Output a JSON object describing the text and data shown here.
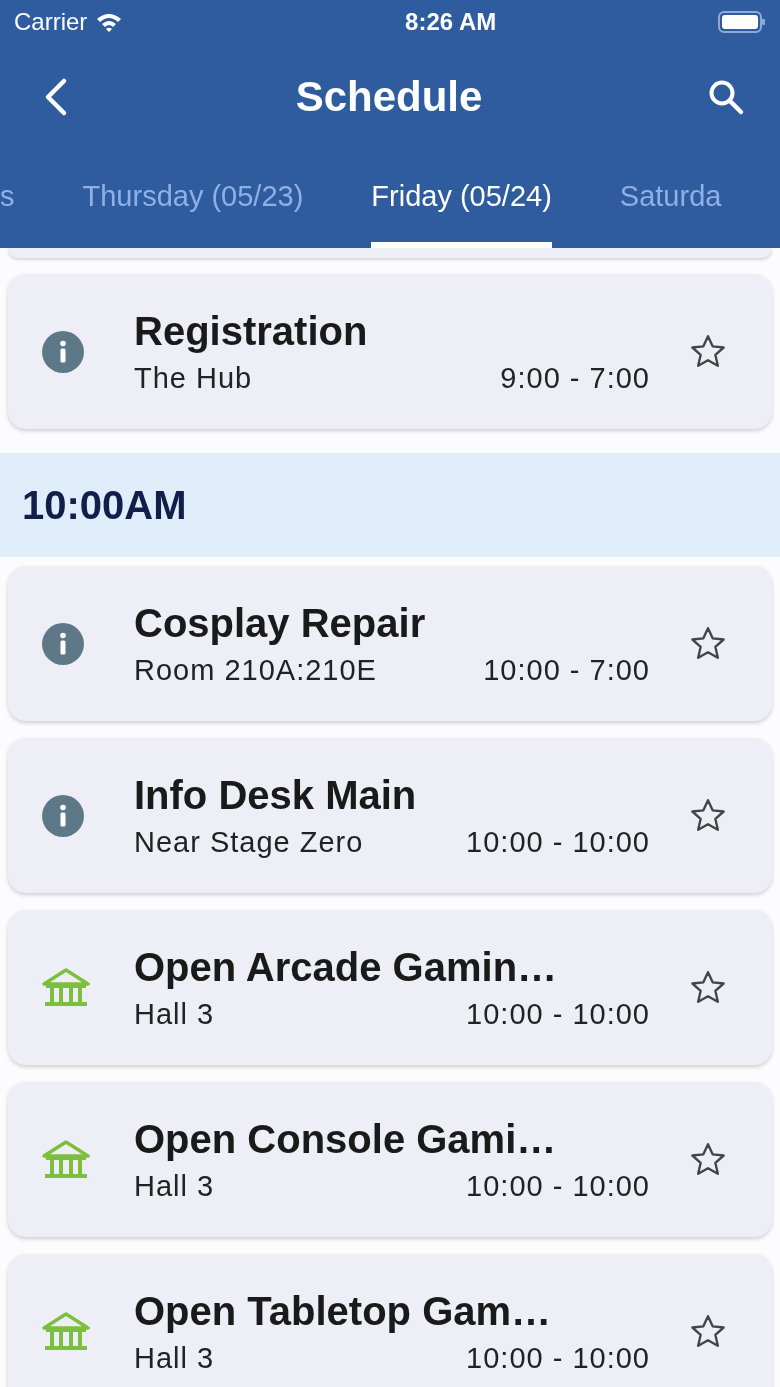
{
  "status_bar": {
    "carrier": "Carrier",
    "time": "8:26 AM"
  },
  "nav": {
    "title": "Schedule"
  },
  "tabs": [
    {
      "label": "s",
      "selected": false
    },
    {
      "label": "Thursday (05/23)",
      "selected": false
    },
    {
      "label": "Friday (05/24)",
      "selected": true
    },
    {
      "label": "Saturda",
      "selected": false
    }
  ],
  "sections": [
    {
      "events": [
        {
          "kind": "info",
          "title": "Registration",
          "location": "The Hub",
          "hours": "9:00 - 7:00",
          "starred": false
        }
      ]
    },
    {
      "time": "10:00AM",
      "events": [
        {
          "kind": "info",
          "title": "Cosplay Repair",
          "location": "Room 210A:210E",
          "hours": "10:00 - 7:00",
          "starred": false
        },
        {
          "kind": "info",
          "title": "Info Desk Main",
          "location": "Near Stage Zero",
          "hours": "10:00 - 10:00",
          "starred": false
        },
        {
          "kind": "venue",
          "title": "Open Arcade Gamin…",
          "location": "Hall 3",
          "hours": "10:00 - 10:00",
          "starred": false
        },
        {
          "kind": "venue",
          "title": "Open Console Gami…",
          "location": "Hall 3",
          "hours": "10:00 - 10:00",
          "starred": false
        },
        {
          "kind": "venue",
          "title": "Open Tabletop Gam…",
          "location": "Hall 3",
          "hours": "10:00 - 10:00",
          "starred": false
        }
      ]
    }
  ]
}
